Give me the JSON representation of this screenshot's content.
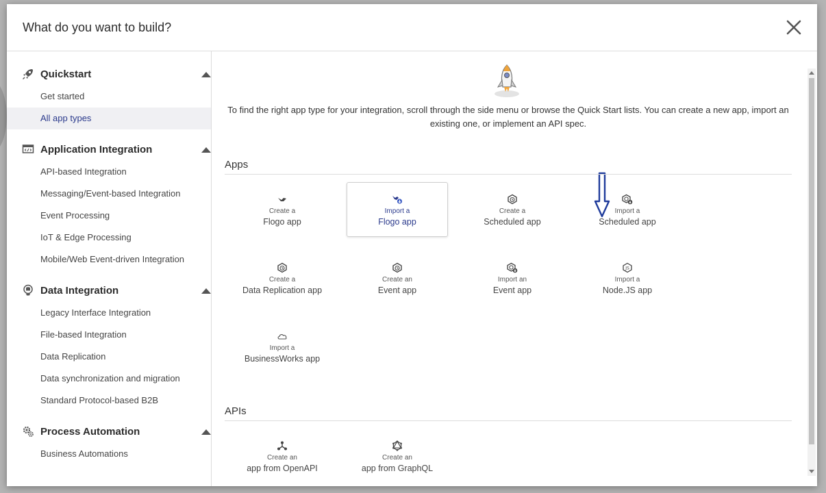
{
  "modal": {
    "title": "What do you want to build?"
  },
  "sidebar": {
    "sections": [
      {
        "title": "Quickstart",
        "icon": "rocket-icon",
        "items": [
          "Get started",
          "All app types"
        ],
        "active": "All app types"
      },
      {
        "title": "Application Integration",
        "icon": "code-window-icon",
        "items": [
          "API-based Integration",
          "Messaging/Event-based Integration",
          "Event Processing",
          "IoT & Edge Processing",
          "Mobile/Web Event-driven Integration"
        ]
      },
      {
        "title": "Data Integration",
        "icon": "database-icon",
        "items": [
          "Legacy Interface Integration",
          "File-based Integration",
          "Data Replication",
          "Data synchronization and migration",
          "Standard Protocol-based B2B"
        ]
      },
      {
        "title": "Process Automation",
        "icon": "gears-icon",
        "items": [
          "Business Automations"
        ]
      }
    ]
  },
  "main": {
    "intro": "To find the right app type for your integration, scroll through the side menu or browse the Quick Start lists. You can create a new app, import an existing one, or implement an API spec.",
    "apps_title": "Apps",
    "apis_title": "APIs",
    "apps": [
      {
        "small": "Create a",
        "big": "Flogo app",
        "icon": "flogo-bird-icon"
      },
      {
        "small": "Import a",
        "big": "Flogo app",
        "icon": "flogo-import-icon",
        "selected": true
      },
      {
        "small": "Create a",
        "big": "Scheduled app",
        "icon": "hexagon-clock-icon"
      },
      {
        "small": "Import a",
        "big": "Scheduled app",
        "icon": "hexagon-clock-import-icon"
      },
      {
        "small": "Create a",
        "big": "Data Replication app",
        "icon": "hexagon-clock-icon"
      },
      {
        "small": "Create an",
        "big": "Event app",
        "icon": "hexagon-clock-icon"
      },
      {
        "small": "Import an",
        "big": "Event app",
        "icon": "hexagon-clock-import-icon"
      },
      {
        "small": "Import a",
        "big": "Node.JS app",
        "icon": "nodejs-icon"
      },
      {
        "small": "Import a",
        "big": "BusinessWorks app",
        "icon": "cloud-icon"
      }
    ],
    "apis": [
      {
        "small": "Create an",
        "big": "app from OpenAPI",
        "icon": "openapi-nodes-icon"
      },
      {
        "small": "Create an",
        "big": "app from GraphQL",
        "icon": "graphql-icon"
      }
    ]
  },
  "colors": {
    "accent": "#2b3a8c",
    "arrow": "#1f3b9b"
  }
}
